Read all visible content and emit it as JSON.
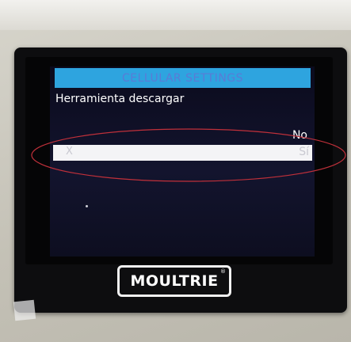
{
  "screen": {
    "title": "CELLULAR SETTINGS",
    "setting_label": "Herramienta descargar",
    "options": [
      {
        "label": "No",
        "selected": false
      },
      {
        "label": "Sí",
        "selected": true
      }
    ],
    "selected_row_marker": "X"
  },
  "device": {
    "logo": "MOULTRIE",
    "logo_mark": "®"
  },
  "colors": {
    "title_bar": "#2ea4df",
    "title_text": "#5a7bd6",
    "screen_bg": "#13142e",
    "selected_row": "#f4f4f6",
    "annotation_ellipse": "#c0303a"
  }
}
